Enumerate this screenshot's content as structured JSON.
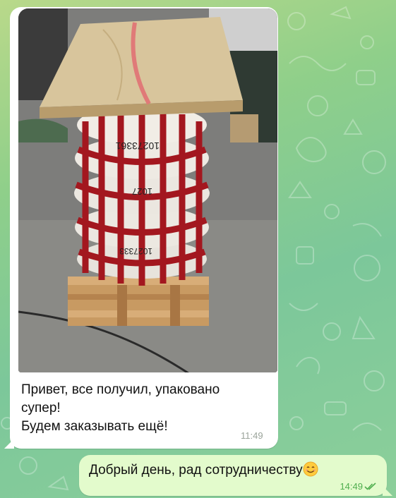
{
  "chat": {
    "incoming": {
      "photo": {
        "label_top": "10273361",
        "label_mid": "1027",
        "label_low": "1027333"
      },
      "text_lines": [
        "Привет, все получил, упаковано",
        "супер!",
        "Будем заказывать ещё!"
      ],
      "time": "11:49"
    },
    "outgoing": {
      "text": "Добрый день, рад сотрудничеству",
      "emoji": "smiling-face-emoji",
      "time": "14:49",
      "status": "read-double-check"
    }
  },
  "colors": {
    "incoming_bubble": "#ffffff",
    "outgoing_bubble": "#e3fbcc",
    "time_in": "#9aa39a",
    "time_out": "#4fae4e",
    "wallpaper": "#8fcf8a"
  }
}
